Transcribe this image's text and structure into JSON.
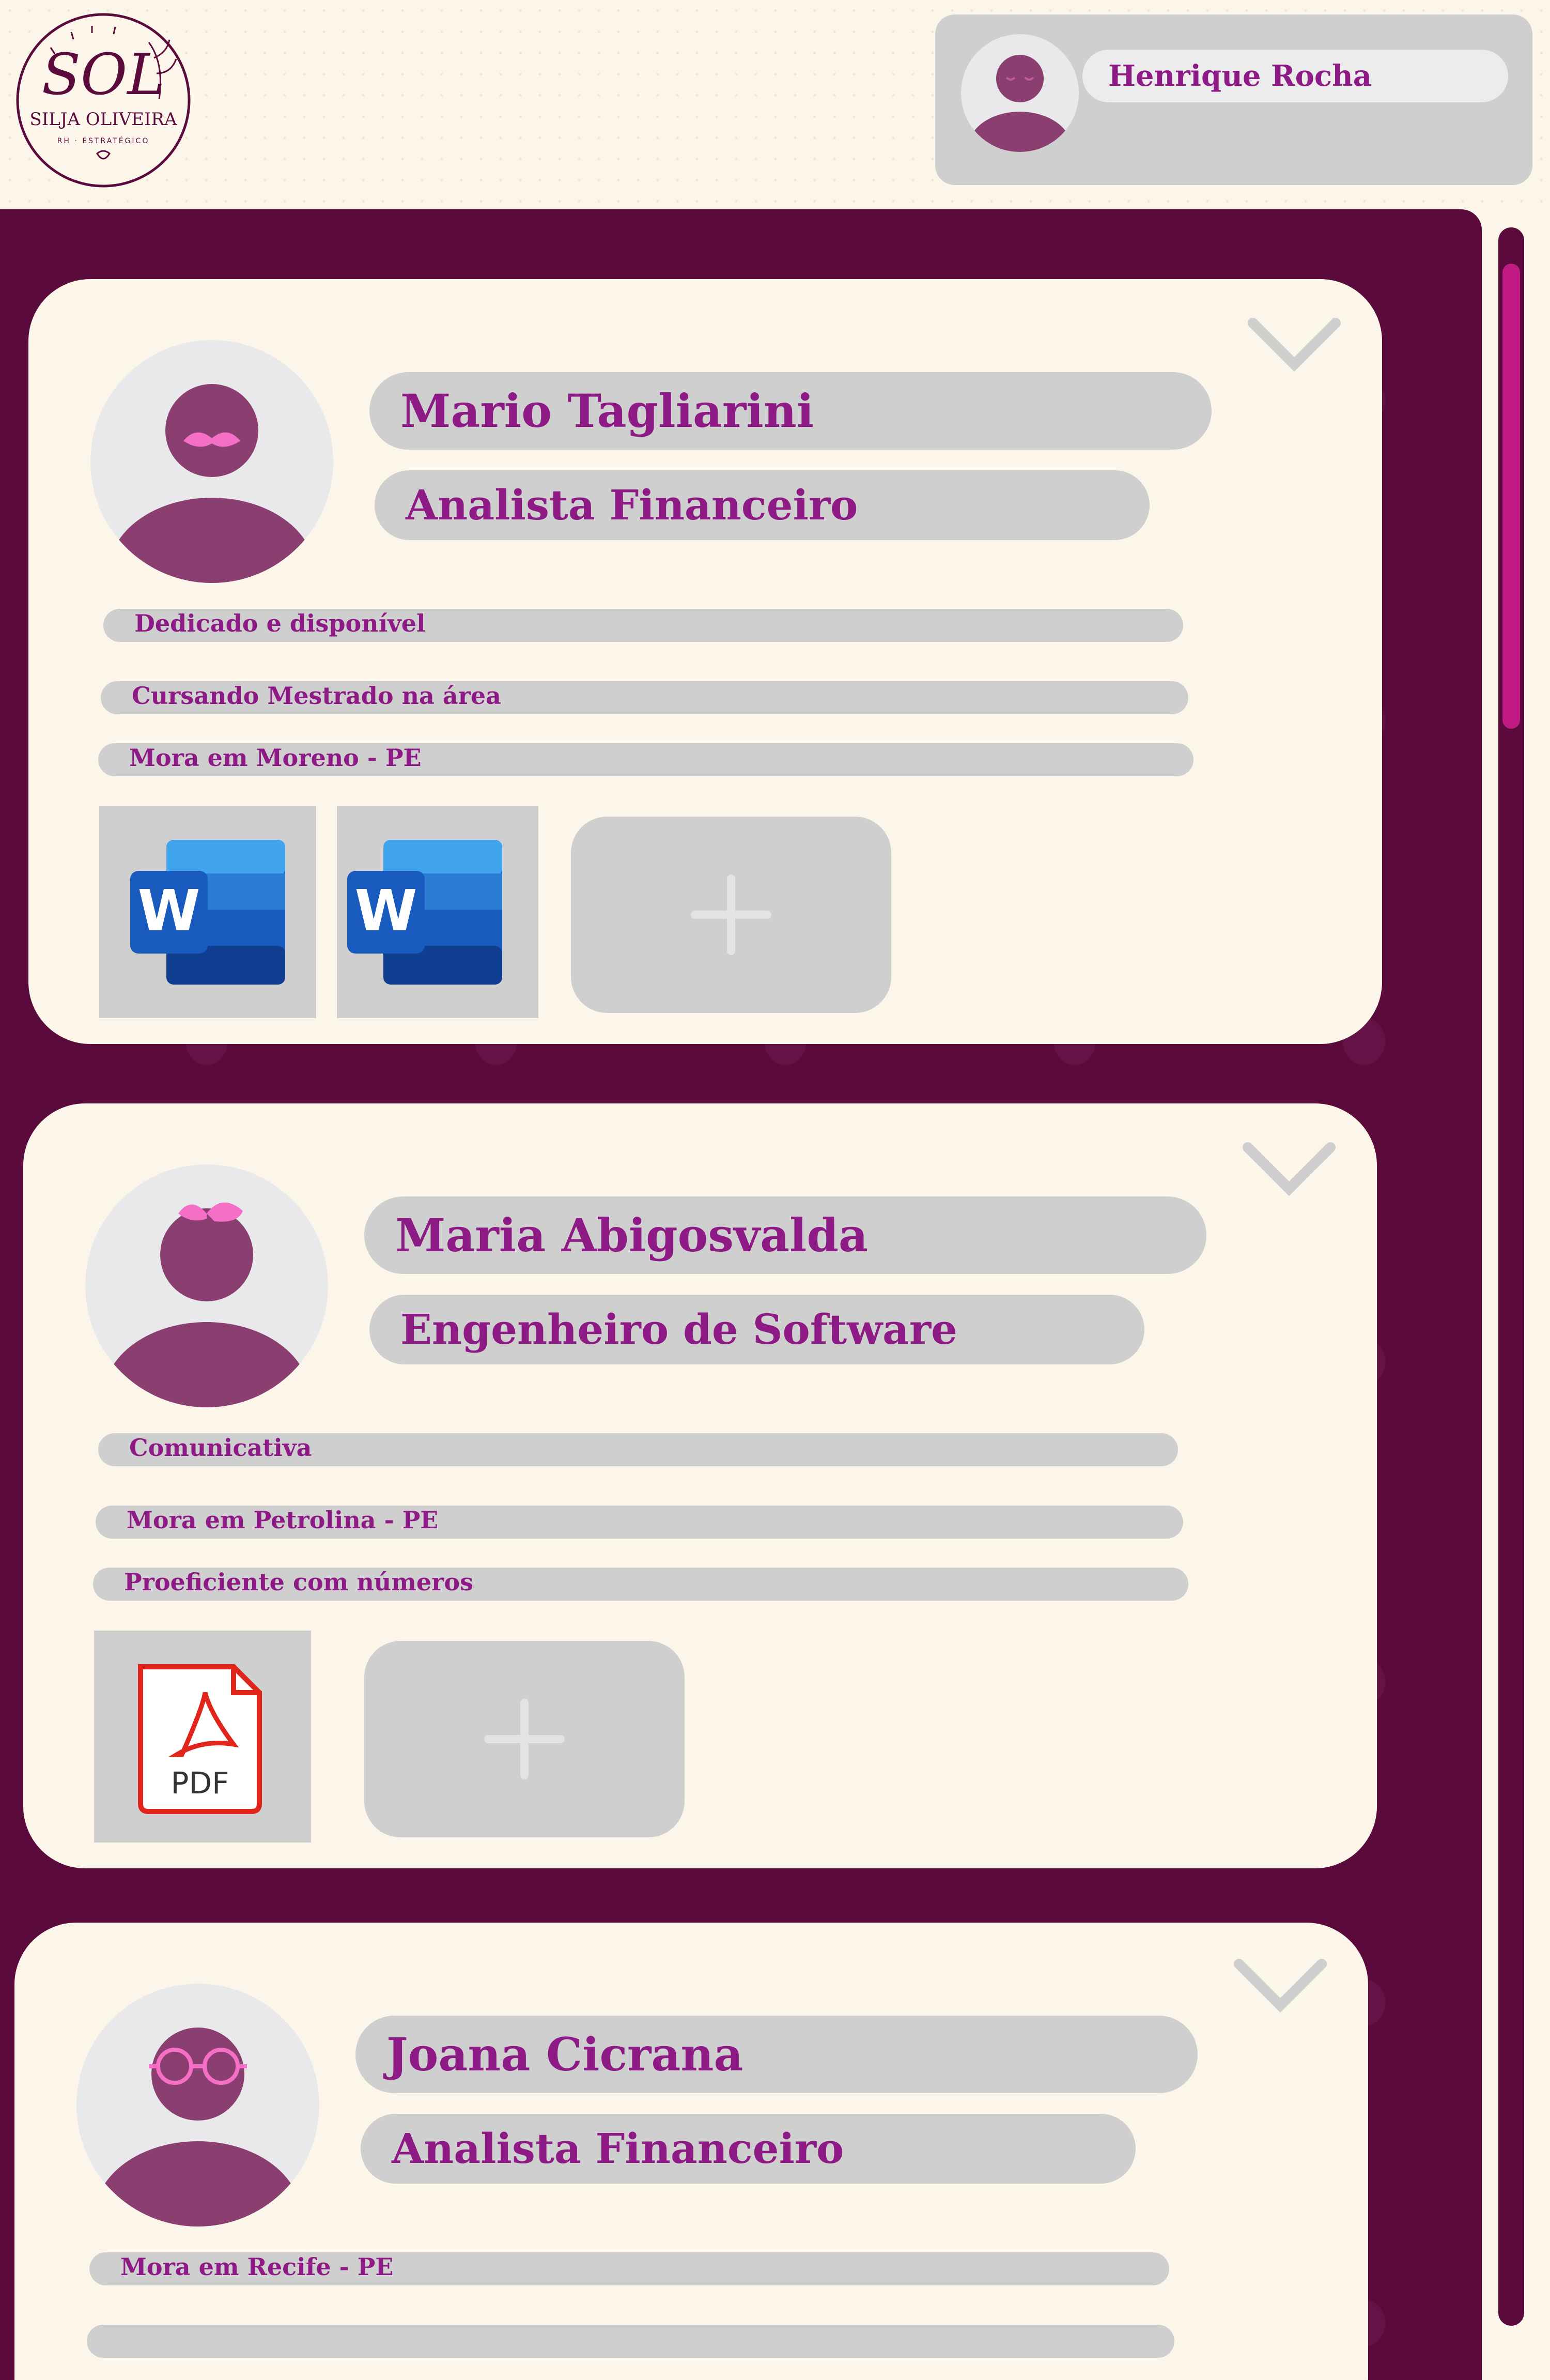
{
  "brand": {
    "logo_text": "SOL",
    "logo_subtitle": "SILJA OLIVEIRA",
    "logo_tagline": "RH · ESTRATÉGICO"
  },
  "user": {
    "name": "Henrique Rocha"
  },
  "colors": {
    "accent": "#8e1a86",
    "panel": "#5b0a3c",
    "pill": "#cfcfcf",
    "card": "#fcf5ea",
    "scroll_thumb": "#c21a83"
  },
  "candidates": [
    {
      "name": "Mario Tagliarini",
      "role": "Analista Financeiro",
      "traits": [
        "Dedicado e disponível",
        "Cursando Mestrado na área",
        "Mora em Moreno - PE"
      ],
      "files": [
        {
          "type": "word",
          "label": "W",
          "icon": "word-icon"
        },
        {
          "type": "word",
          "label": "W",
          "icon": "word-icon"
        }
      ]
    },
    {
      "name": "Maria Abigosvalda",
      "role": "Engenheiro de Software",
      "traits": [
        "Comunicativa",
        "Mora em Petrolina - PE",
        "Proeficiente com números"
      ],
      "files": [
        {
          "type": "pdf",
          "label": "PDF",
          "icon": "pdf-icon"
        }
      ]
    },
    {
      "name": "Joana Cicrana",
      "role": "Analista Financeiro",
      "traits": [
        "Mora em Recife - PE"
      ],
      "files": []
    }
  ]
}
